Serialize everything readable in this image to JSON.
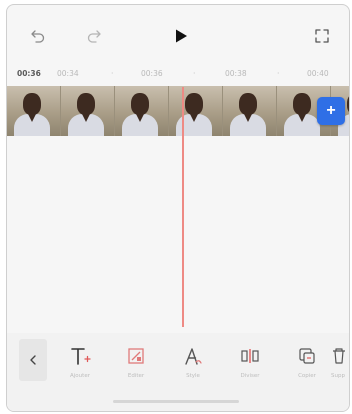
{
  "toolbar": {
    "undo_icon": "undo-icon",
    "redo_icon": "redo-icon",
    "play_icon": "play-icon",
    "fullscreen_icon": "fullscreen-icon"
  },
  "ruler": {
    "current_time": "00:36",
    "marks": [
      "00:34",
      "00:36",
      "00:38",
      "00:40"
    ],
    "dots": [
      "·",
      "·",
      "·"
    ]
  },
  "timeline": {
    "add_button_label": "+",
    "playhead_color": "#ee8a84",
    "accent_color": "#2f6fe6"
  },
  "tools": [
    {
      "label": "Ajouter",
      "icon": "text-add-icon"
    },
    {
      "label": "Editer",
      "icon": "edit-icon"
    },
    {
      "label": "Style",
      "icon": "style-icon"
    },
    {
      "label": "Diviser",
      "icon": "split-icon"
    },
    {
      "label": "Copier",
      "icon": "copy-icon"
    },
    {
      "label": "Supp",
      "icon": "delete-icon"
    }
  ]
}
